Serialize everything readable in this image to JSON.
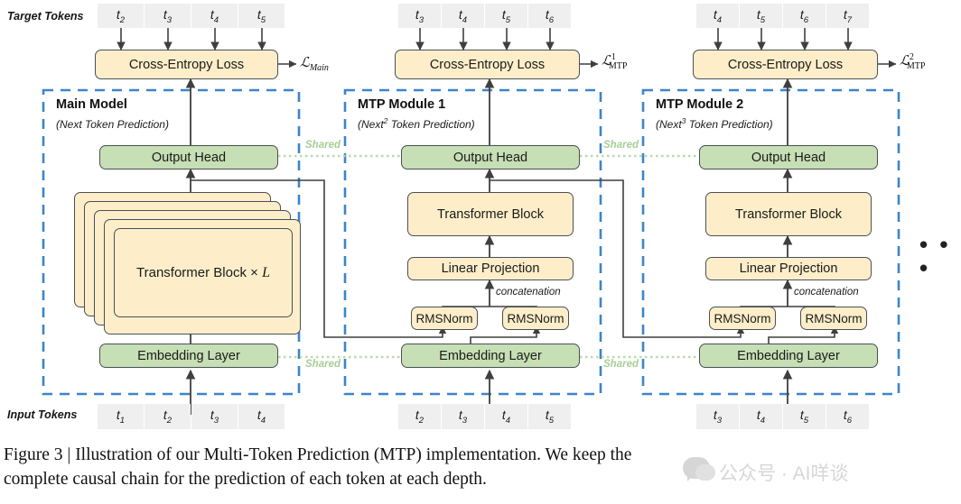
{
  "figure": {
    "caption_line1": "Figure 3 | Illustration of our Multi-Token Prediction (MTP) implementation. We keep the",
    "caption_line2": "complete causal chain for the prediction of each token at each depth.",
    "ellipsis": "• • •"
  },
  "watermark": {
    "text": "公众号 · AI咩谈"
  },
  "row_labels": {
    "target_tokens": "Target Tokens",
    "input_tokens": "Input Tokens"
  },
  "colors": {
    "green_block": "#c6dfb4",
    "cream_block": "#fdeec9",
    "block_border": "#4a4f57",
    "module_border": "#3d85c8",
    "shared_line": "#bcd9ac",
    "token_cell": "#efefef",
    "arrow": "#3f3f3f"
  },
  "common_labels": {
    "cross_entropy_loss": "Cross-Entropy Loss",
    "output_head": "Output Head",
    "embedding_layer": "Embedding Layer",
    "transformer_block": "Transformer Block",
    "linear_projection": "Linear Projection",
    "rmsnorm": "RMSNorm",
    "concatenation": "concatenation",
    "shared": "Shared"
  },
  "columns": [
    {
      "id": "main",
      "module_title": "Main Model",
      "module_subtitle_pre": "(Next",
      "module_subtitle_sup": "",
      "module_subtitle_post": " Token Prediction)",
      "loss_symbol": "ℒ",
      "loss_sub": "Main",
      "loss_sup": "",
      "loss_sub_italic": true,
      "target_tokens": [
        "t₂",
        "t₃",
        "t₄",
        "t₅"
      ],
      "target_tokens_parts": [
        {
          "base": "t",
          "sub": "2"
        },
        {
          "base": "t",
          "sub": "3"
        },
        {
          "base": "t",
          "sub": "4"
        },
        {
          "base": "t",
          "sub": "5"
        }
      ],
      "input_tokens_parts": [
        {
          "base": "t",
          "sub": "1"
        },
        {
          "base": "t",
          "sub": "2"
        },
        {
          "base": "t",
          "sub": "3"
        },
        {
          "base": "t",
          "sub": "4"
        }
      ],
      "trunk_label": "Transformer Block × L",
      "trunk_label_plain": "Transformer Block × ",
      "trunk_label_italic": "L",
      "has_rmsnorm": false,
      "shared_right": "Shared",
      "shared_right_bottom": "Shared"
    },
    {
      "id": "mtp1",
      "module_title": "MTP Module 1",
      "module_subtitle_pre": "(Next",
      "module_subtitle_sup": "2",
      "module_subtitle_post": " Token Prediction)",
      "loss_symbol": "ℒ",
      "loss_sub": "MTP",
      "loss_sup": "1",
      "loss_sub_italic": false,
      "target_tokens_parts": [
        {
          "base": "t",
          "sub": "3"
        },
        {
          "base": "t",
          "sub": "4"
        },
        {
          "base": "t",
          "sub": "5"
        },
        {
          "base": "t",
          "sub": "6"
        }
      ],
      "input_tokens_parts": [
        {
          "base": "t",
          "sub": "2"
        },
        {
          "base": "t",
          "sub": "3"
        },
        {
          "base": "t",
          "sub": "4"
        },
        {
          "base": "t",
          "sub": "5"
        }
      ],
      "trunk_label": "Transformer Block",
      "has_rmsnorm": true,
      "shared_right": "Shared",
      "shared_right_bottom": "Shared"
    },
    {
      "id": "mtp2",
      "module_title": "MTP Module 2",
      "module_subtitle_pre": "(Next",
      "module_subtitle_sup": "3",
      "module_subtitle_post": " Token Prediction)",
      "loss_symbol": "ℒ",
      "loss_sub": "MTP",
      "loss_sup": "2",
      "loss_sub_italic": false,
      "target_tokens_parts": [
        {
          "base": "t",
          "sub": "4"
        },
        {
          "base": "t",
          "sub": "5"
        },
        {
          "base": "t",
          "sub": "6"
        },
        {
          "base": "t",
          "sub": "7"
        }
      ],
      "input_tokens_parts": [
        {
          "base": "t",
          "sub": "3"
        },
        {
          "base": "t",
          "sub": "4"
        },
        {
          "base": "t",
          "sub": "5"
        },
        {
          "base": "t",
          "sub": "6"
        }
      ],
      "trunk_label": "Transformer Block",
      "has_rmsnorm": true,
      "shared_right": "",
      "shared_right_bottom": ""
    }
  ]
}
